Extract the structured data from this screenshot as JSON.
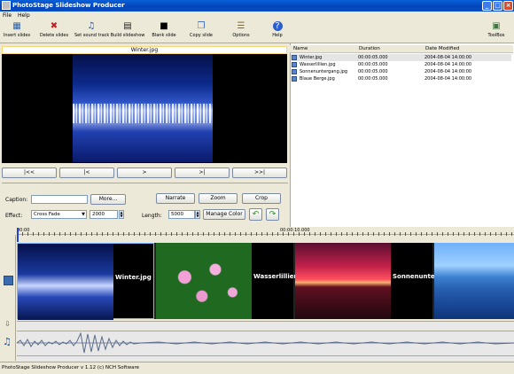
{
  "window": {
    "title": "PhotoStage Slideshow Producer",
    "minimize": "_",
    "maximize": "□",
    "close": "×"
  },
  "menu": [
    "File",
    "Help"
  ],
  "toolbar": [
    {
      "label": "Insert slides",
      "icon": "insert-slides-icon",
      "glyph": "▦"
    },
    {
      "label": "Delete slides",
      "icon": "delete-slides-icon",
      "glyph": "✖"
    },
    {
      "label": "Set sound track",
      "icon": "sound-track-icon",
      "glyph": "♫"
    },
    {
      "label": "Build slideshow",
      "icon": "clapperboard-icon",
      "glyph": "▤"
    },
    {
      "label": "Blank slide",
      "icon": "blank-slide-icon",
      "glyph": "■"
    },
    {
      "label": "Copy slide",
      "icon": "copy-slide-icon",
      "glyph": "❐"
    },
    {
      "label": "Options",
      "icon": "options-icon",
      "glyph": "☰"
    },
    {
      "label": "Help",
      "icon": "help-icon",
      "glyph": "?"
    },
    {
      "label": "ToolBox",
      "icon": "toolbox-icon",
      "glyph": "▣"
    }
  ],
  "preview": {
    "filename": "Winter.jpg"
  },
  "nav": [
    "|<<",
    "|<",
    ">",
    ">|",
    ">>|"
  ],
  "edit": {
    "caption_label": "Caption:",
    "caption_value": "",
    "more": "More...",
    "narrate": "Narrate",
    "zoom": "Zoom",
    "crop": "Crop",
    "effect_label": "Effect:",
    "effect_value": "Cross Fade",
    "effect_duration": "2000",
    "length_label": "Length:",
    "length_value": "5000",
    "manage_color": "Manage Color"
  },
  "files": {
    "columns": [
      "Name",
      "Duration",
      "Date Modified"
    ],
    "rows": [
      {
        "name": "Winter.jpg",
        "duration": "00:00:05.000",
        "date": "2004-08-04 14:00:00"
      },
      {
        "name": "Wasserlillien.jpg",
        "duration": "00:00:05.000",
        "date": "2004-08-04 14:00:00"
      },
      {
        "name": "Sonnenuntergang.jpg",
        "duration": "00:00:05.000",
        "date": "2004-08-04 14:00:00"
      },
      {
        "name": "Blaue Berge.jpg",
        "duration": "00:00:05.000",
        "date": "2004-08-04 14:00:00"
      }
    ]
  },
  "timeline": {
    "ruler": [
      "00:00",
      "00:00:10.000"
    ],
    "clips": [
      "Winter.jpg",
      "Wasserlillien.",
      "Sonnenunterg",
      ""
    ]
  },
  "status": "PhotoStage Slideshow Producer v 1.12 (c) NCH Software"
}
